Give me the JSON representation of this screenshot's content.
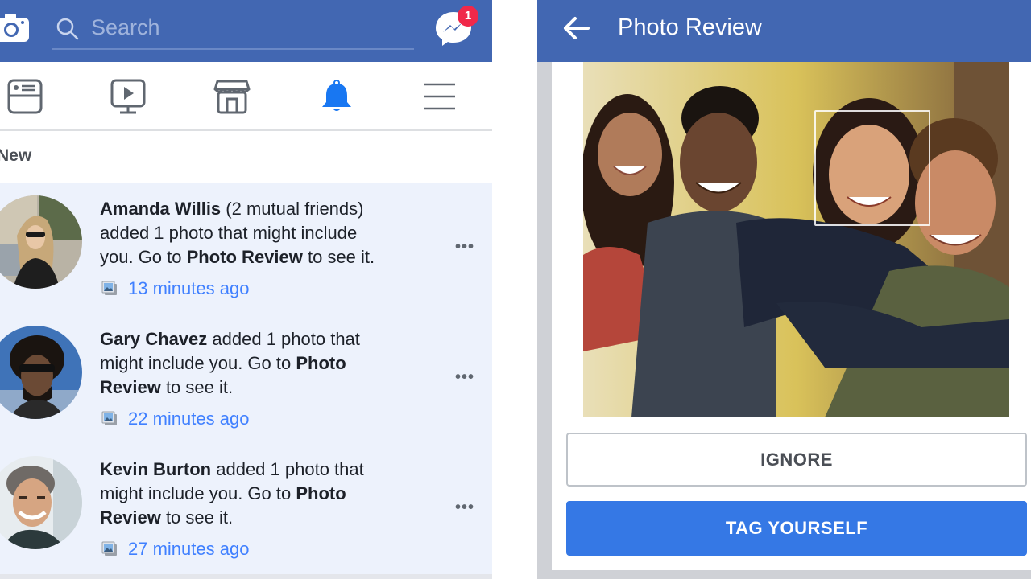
{
  "left_screen": {
    "header": {
      "camera_icon": "camera-icon",
      "search_placeholder": "Search",
      "search_icon": "search-icon",
      "messenger_icon": "messenger-icon",
      "messenger_badge": "1"
    },
    "nav": [
      {
        "name": "news-feed",
        "icon": "news-feed-icon",
        "active": false
      },
      {
        "name": "watch",
        "icon": "video-icon",
        "active": false
      },
      {
        "name": "marketplace",
        "icon": "marketplace-icon",
        "active": false
      },
      {
        "name": "notifications",
        "icon": "bell-icon",
        "active": true
      },
      {
        "name": "menu",
        "icon": "hamburger-icon",
        "active": false
      }
    ],
    "section_heading": "New",
    "notifications": [
      {
        "name": "Amanda Willis",
        "parts": [
          {
            "b": "Amanda Willis"
          },
          {
            "t": " (2 mutual friends) added 1 photo that might include you. Go to "
          },
          {
            "b": "Photo Review"
          },
          {
            "t": " to see it."
          }
        ],
        "line1": "(2 mutual friends)",
        "line2": "added 1 photo that might include",
        "line3_a": "you. Go to ",
        "line3_b": "Photo Review",
        "line3_c": " to see it.",
        "time": "13 minutes ago"
      },
      {
        "name": "Gary Chavez",
        "line1": " added 1 photo that",
        "line2_a": "might include you. Go to ",
        "line2_b": "Photo",
        "line3_a": "Review",
        "line3_b": " to see it.",
        "time": "22 minutes ago"
      },
      {
        "name": "Kevin Burton",
        "line1": " added 1 photo that",
        "line2_a": "might include you. Go to ",
        "line2_b": "Photo",
        "line3_a": "Review",
        "line3_b": " to see it.",
        "time": "27 minutes ago"
      }
    ],
    "more_label": "•••"
  },
  "right_screen": {
    "header": {
      "back_icon": "back-arrow-icon",
      "title": "Photo Review"
    },
    "photo": {
      "description": "Group of four friends smiling outdoors with autumn foliage; face detection box around one face"
    },
    "buttons": {
      "ignore": "IGNORE",
      "tag_yourself": "TAG YOURSELF"
    }
  },
  "colors": {
    "brand_blue": "#4267b2",
    "primary_button": "#3578e5",
    "link_blue": "#4080ff",
    "unread_bg": "#edf2fc",
    "badge_red": "#f02849"
  }
}
